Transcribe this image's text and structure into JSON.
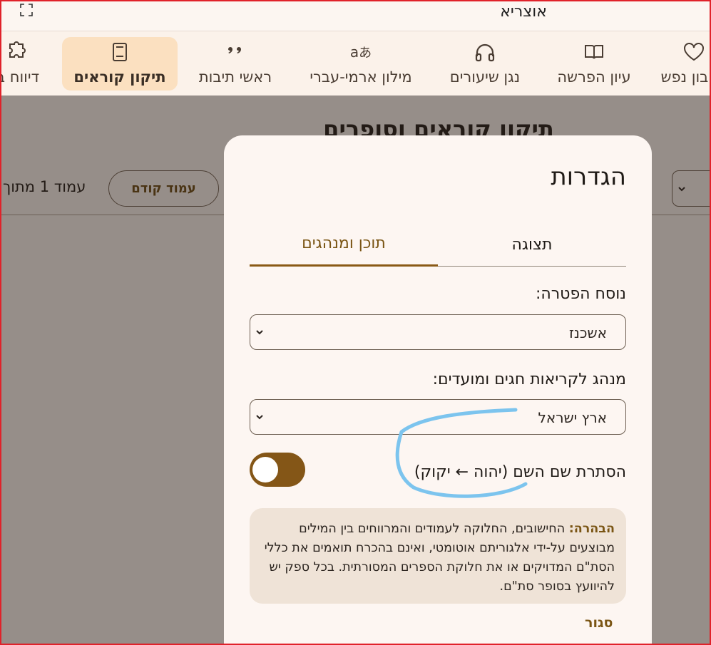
{
  "app": {
    "title": "אוצריא"
  },
  "nav": {
    "items": [
      {
        "key": "reports",
        "label": "דיווח ב",
        "icon": "puzzle-icon"
      },
      {
        "key": "torah-reader",
        "label": "תיקון קוראים",
        "icon": "book-icon",
        "active": true
      },
      {
        "key": "acronyms",
        "label": "ראשי תיבות",
        "icon": "quote-icon"
      },
      {
        "key": "aramaic-dictionary",
        "label": "מילון ארמי-עברי",
        "icon": "translate-icon"
      },
      {
        "key": "lesson-player",
        "label": "נגן שיעורים",
        "icon": "headphones-icon"
      },
      {
        "key": "parasha-study",
        "label": "עיון הפרשה",
        "icon": "open-book-icon"
      },
      {
        "key": "soul-calc",
        "label": "בון נפש",
        "icon": "heart-icon"
      }
    ]
  },
  "page": {
    "title": "תיקון קוראים וסופרים",
    "prev_page": "עמוד קודם",
    "page_indicator": "עמוד 1 מתוך"
  },
  "dialog": {
    "title": "הגדרות",
    "tabs": {
      "display": "תצוגה",
      "content": "תוכן ומנהגים",
      "active": "content"
    },
    "haftarah": {
      "label": "נוסח הפטרה:",
      "value": "אשכנז"
    },
    "holidays": {
      "label": "מנהג לקריאות חגים ומועדים:",
      "value": "ארץ ישראל"
    },
    "hide_name": {
      "label": "הסתרת שם השם (יהוה ← יקוק)",
      "enabled": true
    },
    "disclaimer": {
      "lead": "הבהרה:",
      "text": "החישובים, החלוקה לעמודים והמרווחים בין המילים מבוצעים על-ידי אלגוריתם אוטומטי, ואינם בהכרח תואמים את כללי הסת\"ם המדויקים או את חלוקת הספרים המסורתית. בכל ספק יש להיוועץ בסופר סת\"ם."
    },
    "close": "סגור"
  },
  "colors": {
    "accent": "#845617",
    "active_tab_bg": "#fbe0c0",
    "annotation": "#7cc4ee",
    "frame": "#e0222a"
  }
}
